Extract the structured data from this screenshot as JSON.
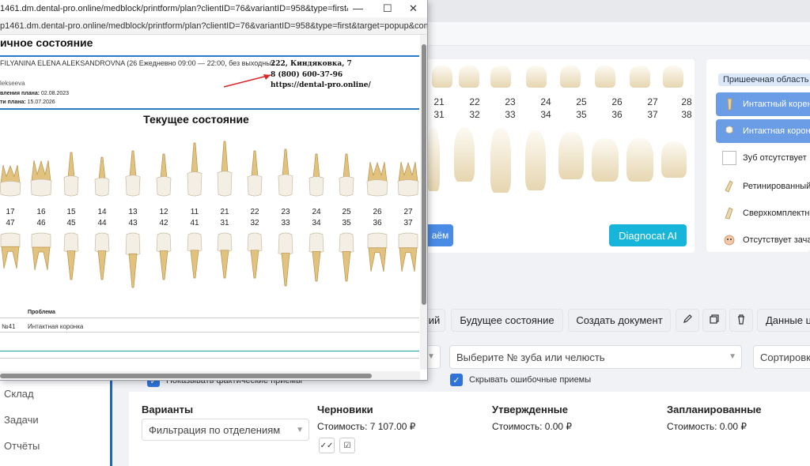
{
  "popup": {
    "title": "1461.dm.dental-pro.online/medblock/printform/plan?clientID=76&variantID=958&type=first&target=popup&comp...",
    "url": "p1461.dm.dental-pro.online/medblock/printform/plan?clientID=76&variantID=958&type=first&target=popup&comp...",
    "controls": {
      "minimize": "—",
      "maximize": "☐",
      "close": "✕"
    },
    "doc": {
      "title": "ичное состояние",
      "doctor": "FILYANINA ELENA ALEKSANDROVNA (26 Ежедневно 09:00 — 22:00, без выходных",
      "patient": "lekseeva",
      "plan_created_label": "вления плана:",
      "plan_created_value": "02.08.2023",
      "plan_valid_label": "ти плана:",
      "plan_valid_value": "15.07.2026",
      "address": "222, Киндяковка, 7",
      "phone": "8 (800) 600-37-96",
      "site": "https://dental-pro.online/",
      "state_title": "Текущее состояние",
      "upper_numbers": [
        "17",
        "16",
        "15",
        "14",
        "13",
        "12",
        "11",
        "21",
        "22",
        "23",
        "24",
        "25",
        "26",
        "27"
      ],
      "lower_numbers": [
        "47",
        "46",
        "45",
        "44",
        "43",
        "42",
        "41",
        "31",
        "32",
        "33",
        "34",
        "35",
        "36",
        "37"
      ],
      "table_header_problem": "Проблема",
      "row_tooth": "№41",
      "row_problem": "Интактная коронка"
    }
  },
  "bg_chart": {
    "upper_numbers": [
      "21",
      "22",
      "23",
      "24",
      "25",
      "26",
      "27",
      "28"
    ],
    "lower_numbers": [
      "31",
      "32",
      "33",
      "34",
      "35",
      "36",
      "37",
      "38"
    ],
    "btn_partial": "аём",
    "btn_ai": "Diagnocat AI"
  },
  "legend": {
    "header": "Пришеечная область",
    "items": [
      {
        "label": "Интактный корень",
        "selected": true
      },
      {
        "label": "Интактная коронка",
        "selected": true
      },
      {
        "label": "Зуб отсутствует",
        "selected": false
      },
      {
        "label": "Ретинированный",
        "selected": false
      },
      {
        "label": "Сверхкомплектный",
        "selected": false
      },
      {
        "label": "Отсутствует зачаток",
        "selected": false
      }
    ]
  },
  "actions": {
    "partial": "ий",
    "future": "Будущее состояние",
    "create_doc": "Создать документ",
    "data": "Данные ц"
  },
  "filters": {
    "tooth_placeholder": "Выберите № зуба или челюсть",
    "sort": "Сортировка",
    "show_actual": "Показывать фактические приемы",
    "hide_errors": "Скрывать ошибочные приемы"
  },
  "sidebar": {
    "items": [
      "Склад",
      "Задачи",
      "Отчёты"
    ]
  },
  "plans": {
    "variants": "Варианты",
    "dept_filter": "Фильтрация по отделениям",
    "drafts": "Черновики",
    "drafts_cost": "Стоимость: 7 107.00 ₽",
    "approved": "Утвержденные",
    "approved_cost": "Стоимость: 0.00 ₽",
    "planned": "Запланированные",
    "planned_cost": "Стоимость: 0.00 ₽"
  },
  "colors": {
    "accent": "#2f73d9",
    "ai": "#16b5d9",
    "rule": "#2a79c9",
    "arrow": "#d9262b"
  }
}
